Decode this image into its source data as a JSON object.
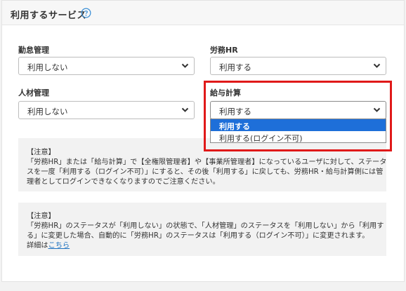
{
  "header": {
    "title": "利用するサービス",
    "help_icon": "question-circle-icon"
  },
  "fields": {
    "attendance": {
      "label": "勤怠管理",
      "value": "利用しない"
    },
    "romu_hr": {
      "label": "労務HR",
      "value": "利用する"
    },
    "talent": {
      "label": "人材管理",
      "value": "利用しない"
    },
    "payroll": {
      "label": "給与計算",
      "value": "利用する",
      "options": [
        "利用する",
        "利用する(ログイン不可)"
      ],
      "highlighted_option": "利用する"
    }
  },
  "notice1": {
    "lines": [
      "【注意】",
      "「労務HR」または「給与計算」で【全権限管理者】や【事業所管理者】になっているユーザに対して、ステータ",
      "スを一度「利用する（ログイン不可）」にすると、その後「利用する」に戻しても、労務HR・給与計算側には管",
      "理者としてログインできなくなりますのでご注意ください。"
    ]
  },
  "notice2": {
    "lines": [
      "【注意】",
      "「労務HR」のステータスが「利用しない」の状態で、「人材管理」のステータスを「利用しない」から「利用す",
      "る」に変更した場合、自動的に「労務HR」のステータスは「利用する（ログイン不可）」に変更されます。"
    ],
    "detail_prefix": "詳細は",
    "detail_link": "こちら"
  },
  "colors": {
    "accent": "#1e6fd9",
    "highlight_border": "#e01919",
    "link": "#1a6fbf"
  }
}
